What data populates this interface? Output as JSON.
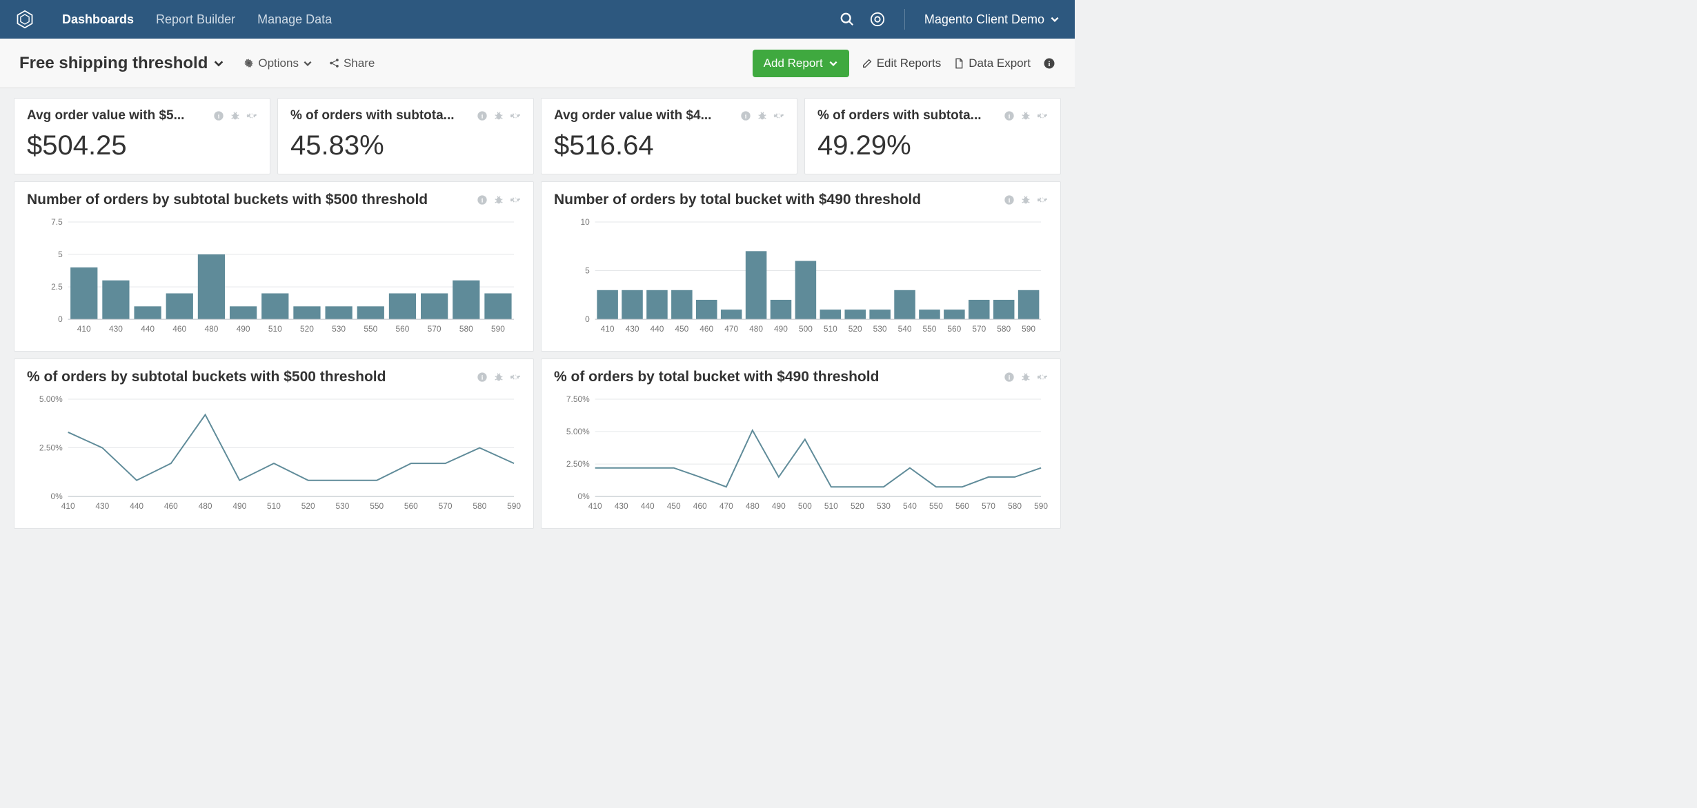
{
  "nav": {
    "links": [
      "Dashboards",
      "Report Builder",
      "Manage Data"
    ],
    "active_index": 0,
    "account_label": "Magento Client Demo"
  },
  "subbar": {
    "dashboard_title": "Free shipping threshold",
    "options_label": "Options",
    "share_label": "Share",
    "add_report_label": "Add Report",
    "edit_reports_label": "Edit Reports",
    "data_export_label": "Data Export"
  },
  "metrics": [
    {
      "title": "Avg order value with $5...",
      "value": "$504.25"
    },
    {
      "title": "% of orders with subtota...",
      "value": "45.83%"
    },
    {
      "title": "Avg order value with $4...",
      "value": "$516.64"
    },
    {
      "title": "% of orders with subtota...",
      "value": "49.29%"
    }
  ],
  "charts": {
    "bar500": {
      "title": "Number of orders by subtotal buckets with $500 threshold"
    },
    "bar490": {
      "title": "Number of orders by total bucket with $490 threshold"
    },
    "line500": {
      "title": "% of orders by subtotal buckets with $500 threshold"
    },
    "line490": {
      "title": "% of orders by total bucket with $490 threshold"
    }
  },
  "chart_data": [
    {
      "id": "bar500",
      "type": "bar",
      "title": "Number of orders by subtotal buckets with $500 threshold",
      "categories": [
        410,
        430,
        440,
        460,
        480,
        490,
        510,
        520,
        530,
        550,
        560,
        570,
        580,
        590
      ],
      "values": [
        4,
        3,
        1,
        2,
        5,
        1,
        2,
        1,
        1,
        1,
        2,
        2,
        3,
        2
      ],
      "ylim": [
        0,
        7.5
      ],
      "yticks": [
        0,
        2.5,
        5,
        7.5
      ],
      "xlabel": "",
      "ylabel": ""
    },
    {
      "id": "bar490",
      "type": "bar",
      "title": "Number of orders by total bucket with $490 threshold",
      "categories": [
        410,
        430,
        440,
        450,
        460,
        470,
        480,
        490,
        500,
        510,
        520,
        530,
        540,
        550,
        560,
        570,
        580,
        590
      ],
      "values": [
        3,
        3,
        3,
        3,
        2,
        1,
        7,
        2,
        6,
        1,
        1,
        1,
        3,
        1,
        1,
        2,
        2,
        3
      ],
      "ylim": [
        0,
        10
      ],
      "yticks": [
        0,
        5,
        10
      ],
      "xlabel": "",
      "ylabel": ""
    },
    {
      "id": "line500",
      "type": "line",
      "title": "% of orders by subtotal buckets with $500 threshold",
      "x": [
        410,
        430,
        440,
        460,
        480,
        490,
        510,
        520,
        530,
        550,
        560,
        570,
        580,
        590
      ],
      "y": [
        3.3,
        2.5,
        0.83,
        1.7,
        4.2,
        0.83,
        1.7,
        0.83,
        0.83,
        0.83,
        1.7,
        1.7,
        2.5,
        1.7
      ],
      "ylim": [
        0,
        5
      ],
      "yticks": [
        "0%",
        "2.50%",
        "5.00%"
      ],
      "xlabel": "",
      "ylabel": ""
    },
    {
      "id": "line490",
      "type": "line",
      "title": "% of orders by total bucket with $490 threshold",
      "x": [
        410,
        430,
        440,
        450,
        460,
        470,
        480,
        490,
        500,
        510,
        520,
        530,
        540,
        550,
        560,
        570,
        580,
        590
      ],
      "y": [
        2.2,
        2.2,
        2.2,
        2.2,
        1.5,
        0.74,
        5.1,
        1.5,
        4.4,
        0.74,
        0.74,
        0.74,
        2.2,
        0.74,
        0.74,
        1.5,
        1.5,
        2.2
      ],
      "ylim": [
        0,
        7.5
      ],
      "yticks": [
        "0%",
        "2.50%",
        "5.00%",
        "7.50%"
      ],
      "xlabel": "",
      "ylabel": ""
    }
  ]
}
